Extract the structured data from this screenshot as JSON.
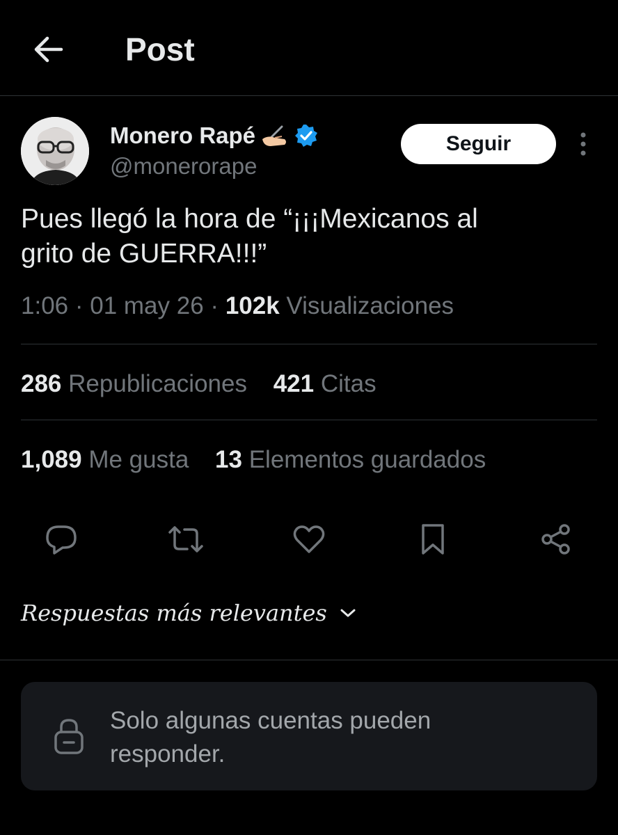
{
  "header": {
    "title": "Post",
    "back_icon": "arrow-left-icon"
  },
  "author": {
    "name": "Monero Rapé",
    "emoji_icon": "writing-hand-icon",
    "verified_icon": "verified-badge-icon",
    "handle": "@monerorape",
    "follow_label": "Seguir",
    "more_icon": "more-vertical-icon",
    "avatar_icon": "avatar-icon"
  },
  "tweet": {
    "text_line1": "Pues llegó la hora de “¡¡¡Mexicanos al",
    "text_line2": "grito de GUERRA!!!”",
    "time": "1:06",
    "date": "01 may 26",
    "views_count": "102k",
    "views_label": "Visualizaciones",
    "separator": "·"
  },
  "stats": {
    "reposts_count": "286",
    "reposts_label": "Republicaciones",
    "quotes_count": "421",
    "quotes_label": "Citas",
    "likes_count": "1,089",
    "likes_label": "Me gusta",
    "bookmarks_count": "13",
    "bookmarks_label": "Elementos guardados"
  },
  "actions": [
    "reply-icon",
    "repost-icon",
    "like-icon",
    "bookmark-icon",
    "share-icon"
  ],
  "replies": {
    "sort_label": "Respuestas más relevantes",
    "sort_icon": "chevron-down-icon",
    "restricted_line1": "Solo algunas cuentas pueden",
    "restricted_line2": "responder.",
    "lock_icon": "lock-icon"
  },
  "colors": {
    "background": "#000000",
    "text": "#e7e9ea",
    "muted": "#71767b",
    "border": "#2f3336",
    "verified": "#1d9bf0",
    "box": "#16181c"
  }
}
